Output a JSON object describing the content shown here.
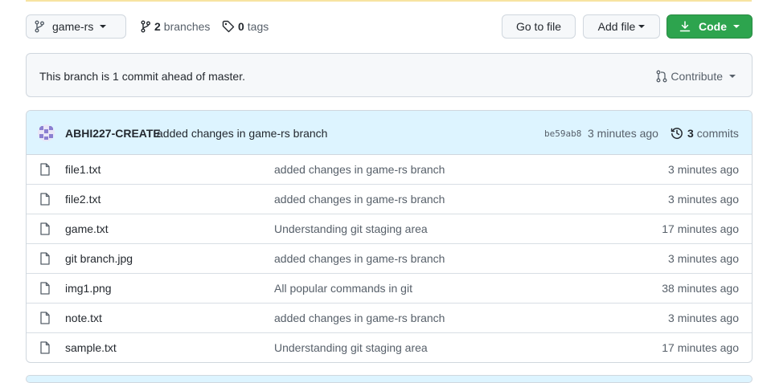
{
  "toolbar": {
    "branch_name": "game-rs",
    "branches_count": "2",
    "branches_label": "branches",
    "tags_count": "0",
    "tags_label": "tags",
    "goto_label": "Go to file",
    "add_file_label": "Add file",
    "code_label": "Code"
  },
  "ahead": {
    "text": "This branch is 1 commit ahead of master.",
    "contribute_label": "Contribute"
  },
  "latest_commit": {
    "author": "ABHI227-CREATE",
    "message": "added changes in game-rs branch",
    "sha": "be59ab8",
    "time": "3 minutes ago",
    "commit_count": "3",
    "commits_label": "commits"
  },
  "files": [
    {
      "name": "file1.txt",
      "message": "added changes in game-rs branch",
      "time": "3 minutes ago"
    },
    {
      "name": "file2.txt",
      "message": "added changes in game-rs branch",
      "time": "3 minutes ago"
    },
    {
      "name": "game.txt",
      "message": "Understanding git staging area",
      "time": "17 minutes ago"
    },
    {
      "name": "git branch.jpg",
      "message": "added changes in game-rs branch",
      "time": "3 minutes ago"
    },
    {
      "name": "img1.png",
      "message": "All popular commands in git",
      "time": "38 minutes ago"
    },
    {
      "name": "note.txt",
      "message": "added changes in game-rs branch",
      "time": "3 minutes ago"
    },
    {
      "name": "sample.txt",
      "message": "Understanding git staging area",
      "time": "17 minutes ago"
    }
  ],
  "colors": {
    "accent_green": "#2da44e",
    "commit_header_bg": "#ddf4ff",
    "border": "#d0d7de",
    "muted_text": "#57606a"
  },
  "icons": [
    "git-branch-icon",
    "tag-icon",
    "download-icon",
    "pull-request-icon",
    "history-icon",
    "file-icon",
    "avatar"
  ]
}
